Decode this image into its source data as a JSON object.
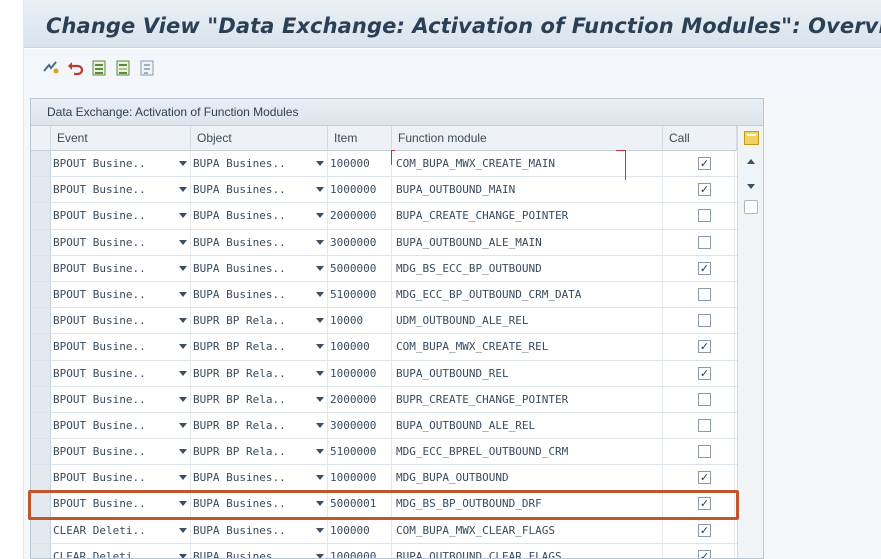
{
  "title": "Change View \"Data Exchange: Activation of Function Modules\": Overview",
  "toolbar": [
    {
      "name": "other-entry-icon",
      "label": ""
    },
    {
      "name": "undo-icon",
      "label": ""
    },
    {
      "name": "select-all-icon",
      "label": ""
    },
    {
      "name": "select-block-icon",
      "label": ""
    },
    {
      "name": "deselect-all-icon",
      "label": ""
    }
  ],
  "table": {
    "title": "Data Exchange: Activation of Function Modules",
    "columns": [
      "Event",
      "Object",
      "Item",
      "Function module",
      "Call"
    ],
    "rows": [
      {
        "event": "BPOUT Busine..",
        "object": "BUPA Busines..",
        "item": "100000",
        "function_module": "COM_BUPA_MWX_CREATE_MAIN",
        "call": true
      },
      {
        "event": "BPOUT Busine..",
        "object": "BUPA Busines..",
        "item": "1000000",
        "function_module": "BUPA_OUTBOUND_MAIN",
        "call": true
      },
      {
        "event": "BPOUT Busine..",
        "object": "BUPA Busines..",
        "item": "2000000",
        "function_module": "BUPA_CREATE_CHANGE_POINTER",
        "call": false
      },
      {
        "event": "BPOUT Busine..",
        "object": "BUPA Busines..",
        "item": "3000000",
        "function_module": "BUPA_OUTBOUND_ALE_MAIN",
        "call": false
      },
      {
        "event": "BPOUT Busine..",
        "object": "BUPA Busines..",
        "item": "5000000",
        "function_module": "MDG_BS_ECC_BP_OUTBOUND",
        "call": true
      },
      {
        "event": "BPOUT Busine..",
        "object": "BUPA Busines..",
        "item": "5100000",
        "function_module": "MDG_ECC_BP_OUTBOUND_CRM_DATA",
        "call": false
      },
      {
        "event": "BPOUT Busine..",
        "object": "BUPR BP Rela..",
        "item": "10000",
        "function_module": "UDM_OUTBOUND_ALE_REL",
        "call": false
      },
      {
        "event": "BPOUT Busine..",
        "object": "BUPR BP Rela..",
        "item": "100000",
        "function_module": "COM_BUPA_MWX_CREATE_REL",
        "call": true
      },
      {
        "event": "BPOUT Busine..",
        "object": "BUPR BP Rela..",
        "item": "1000000",
        "function_module": "BUPA_OUTBOUND_REL",
        "call": true
      },
      {
        "event": "BPOUT Busine..",
        "object": "BUPR BP Rela..",
        "item": "2000000",
        "function_module": "BUPR_CREATE_CHANGE_POINTER",
        "call": false
      },
      {
        "event": "BPOUT Busine..",
        "object": "BUPR BP Rela..",
        "item": "3000000",
        "function_module": "BUPA_OUTBOUND_ALE_REL",
        "call": false
      },
      {
        "event": "BPOUT Busine..",
        "object": "BUPR BP Rela..",
        "item": "5100000",
        "function_module": "MDG_ECC_BPREL_OUTBOUND_CRM",
        "call": false
      },
      {
        "event": "BPOUT Busine..",
        "object": "BUPA Busines..",
        "item": "1000000",
        "function_module": "MDG_BUPA_OUTBOUND",
        "call": true
      },
      {
        "event": "BPOUT Busine..",
        "object": "BUPA Busines..",
        "item": "5000001",
        "function_module": "MDG_BS_BP_OUTBOUND_DRF",
        "call": true
      },
      {
        "event": "CLEAR Deleti..",
        "object": "BUPA Busines..",
        "item": "100000",
        "function_module": "COM_BUPA_MWX_CLEAR_FLAGS",
        "call": true
      },
      {
        "event": "CLEAR Deleti..",
        "object": "BUPA Busines..",
        "item": "1000000",
        "function_module": "BUPA_OUTBOUND_CLEAR_FLAGS",
        "call": true
      }
    ],
    "checked_mark": "✓"
  },
  "colors": {
    "highlight": "#c0562b",
    "title": "#2b3f55"
  }
}
